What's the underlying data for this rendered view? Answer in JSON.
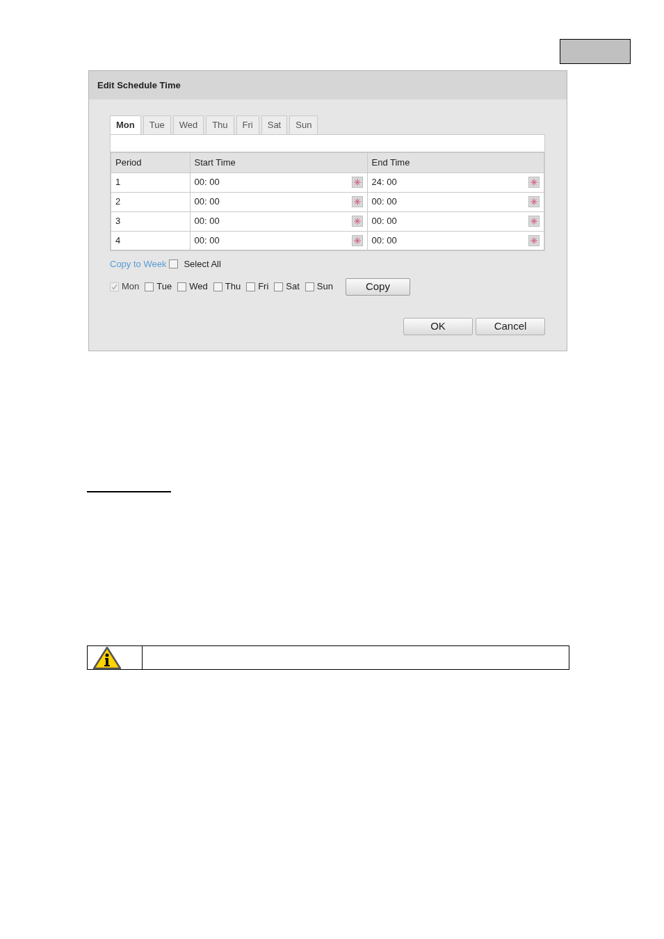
{
  "dialog": {
    "title": "Edit Schedule Time",
    "tabs": [
      {
        "label": "Mon",
        "selected": true
      },
      {
        "label": "Tue",
        "selected": false
      },
      {
        "label": "Wed",
        "selected": false
      },
      {
        "label": "Thu",
        "selected": false
      },
      {
        "label": "Fri",
        "selected": false
      },
      {
        "label": "Sat",
        "selected": false
      },
      {
        "label": "Sun",
        "selected": false
      }
    ],
    "table": {
      "columns": [
        "Period",
        "Start Time",
        "End Time"
      ],
      "rows": [
        {
          "period": "1",
          "start": "00: 00",
          "end": "24: 00"
        },
        {
          "period": "2",
          "start": "00: 00",
          "end": "00: 00"
        },
        {
          "period": "3",
          "start": "00: 00",
          "end": "00: 00"
        },
        {
          "period": "4",
          "start": "00: 00",
          "end": "00: 00"
        }
      ]
    },
    "copy_to_week": "Copy to Week",
    "select_all": {
      "label": "Select All",
      "checked": false
    },
    "days": [
      {
        "label": "Mon",
        "checked": true,
        "disabled": true
      },
      {
        "label": "Tue",
        "checked": false,
        "disabled": false
      },
      {
        "label": "Wed",
        "checked": false,
        "disabled": false
      },
      {
        "label": "Thu",
        "checked": false,
        "disabled": false
      },
      {
        "label": "Fri",
        "checked": false,
        "disabled": false
      },
      {
        "label": "Sat",
        "checked": false,
        "disabled": false
      },
      {
        "label": "Sun",
        "checked": false,
        "disabled": false
      }
    ],
    "copy_button": "Copy",
    "buttons": [
      "OK",
      "Cancel"
    ]
  }
}
